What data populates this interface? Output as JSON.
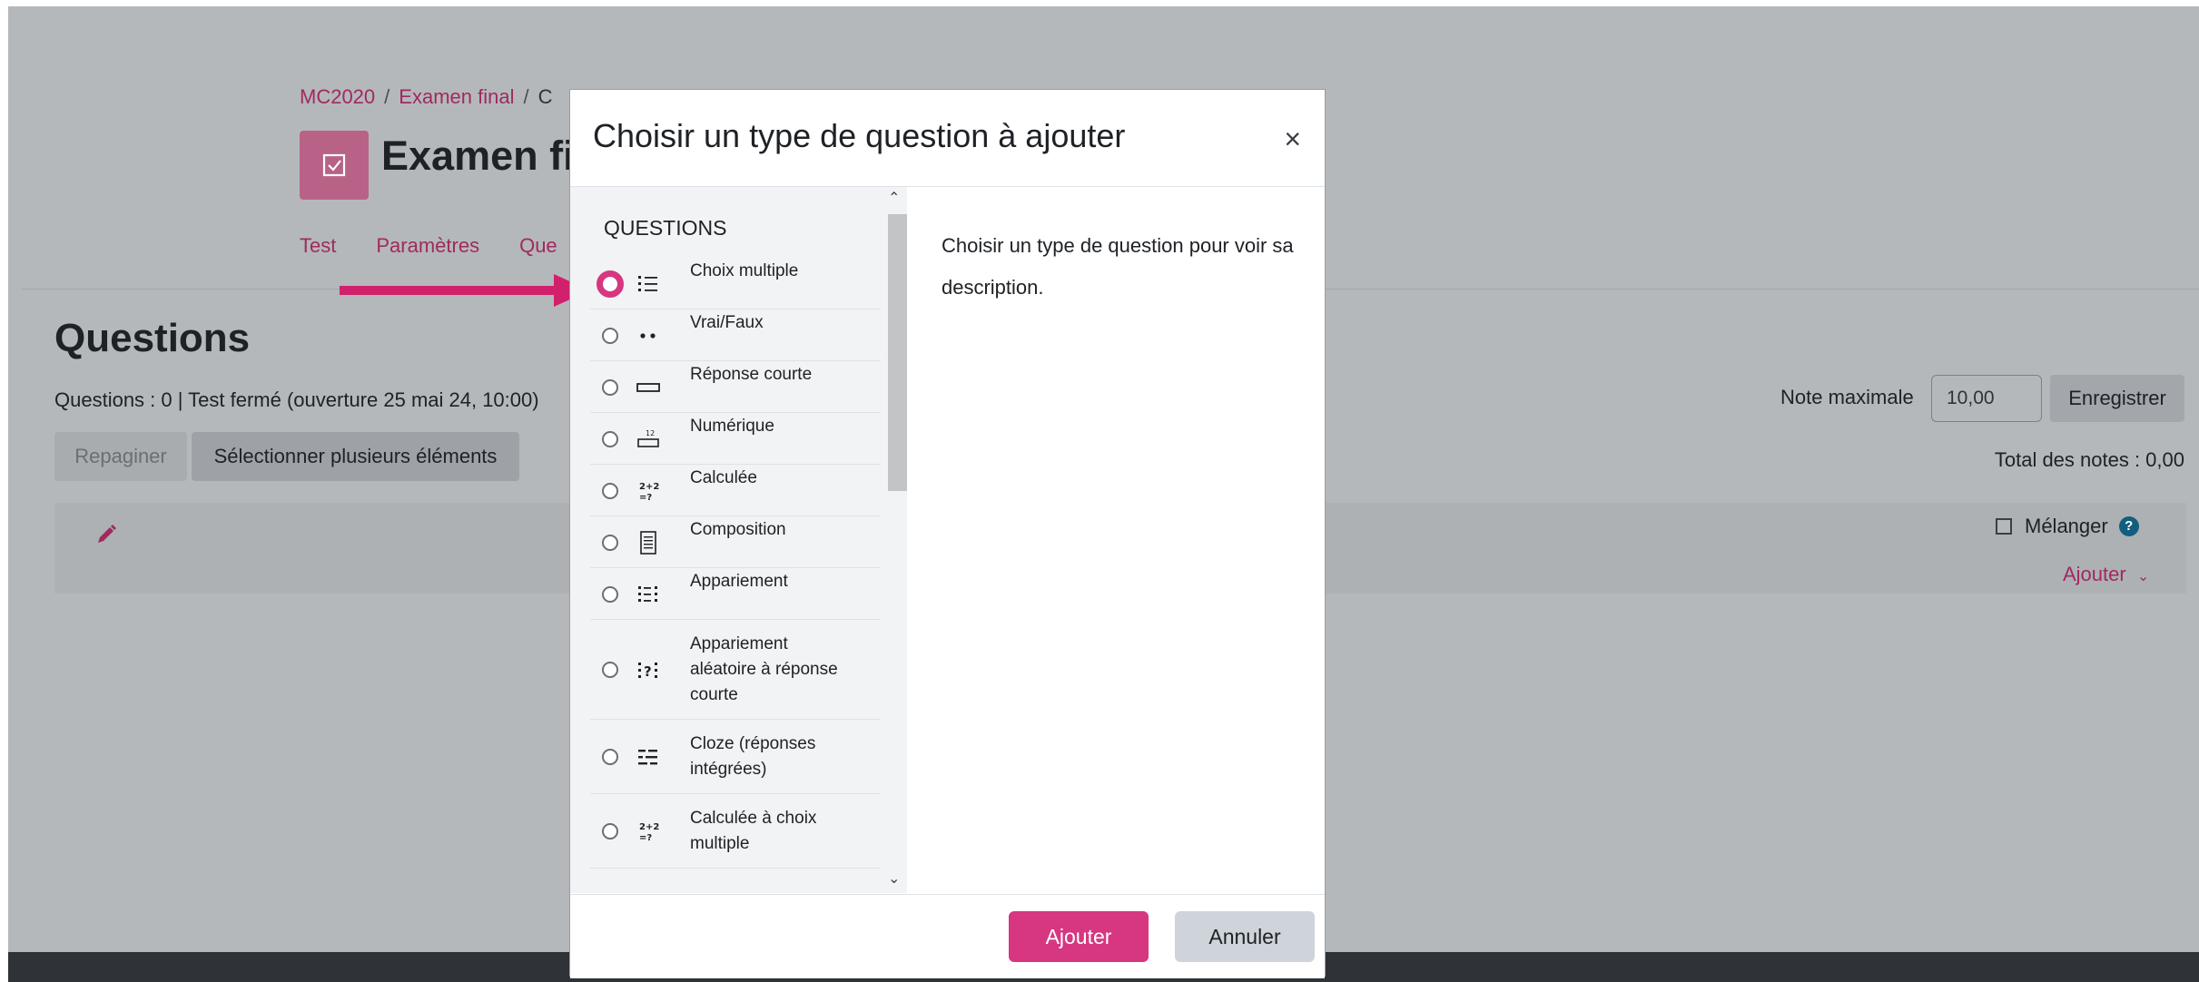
{
  "breadcrumb": {
    "items": [
      "MC2020",
      "Examen final",
      "C"
    ]
  },
  "quiz": {
    "title": "Examen fi"
  },
  "navtabs": [
    "Test",
    "Paramètres",
    "Que"
  ],
  "questions_section": {
    "title": "Questions",
    "info": "Questions : 0 | Test fermé (ouverture 25 mai 24, 10:00)",
    "repaginer_label": "Repaginer",
    "select_multiple_label": "Sélectionner plusieurs éléments",
    "note_max_label": "Note maximale",
    "note_max_value": "10,00",
    "enregistrer_label": "Enregistrer",
    "total_notes": "Total des notes : 0,00",
    "melanger_label": "Mélanger",
    "ajouter_label": "Ajouter"
  },
  "modal": {
    "title": "Choisir un type de question à ajouter",
    "close_symbol": "×",
    "list_heading": "QUESTIONS",
    "description": "Choisir un type de question pour voir sa description.",
    "add_label": "Ajouter",
    "cancel_label": "Annuler",
    "selected_index": 0,
    "question_types": [
      {
        "label": "Choix multiple",
        "icon": "multichoice-icon"
      },
      {
        "label": "Vrai/Faux",
        "icon": "truefalse-icon"
      },
      {
        "label": "Réponse courte",
        "icon": "shortanswer-icon"
      },
      {
        "label": "Numérique",
        "icon": "numerical-icon"
      },
      {
        "label": "Calculée",
        "icon": "calculated-icon"
      },
      {
        "label": "Composition",
        "icon": "essay-icon"
      },
      {
        "label": "Appariement",
        "icon": "match-icon"
      },
      {
        "label": "Appariement aléatoire à réponse courte",
        "icon": "randomsamatch-icon"
      },
      {
        "label": "Cloze (réponses intégrées)",
        "icon": "multianswer-icon"
      },
      {
        "label": "Calculée à choix multiple",
        "icon": "calculatedmulti-icon"
      }
    ]
  },
  "colors": {
    "accent": "#d63780",
    "link": "#a02a5f",
    "overlay": "#b5b8bb"
  }
}
